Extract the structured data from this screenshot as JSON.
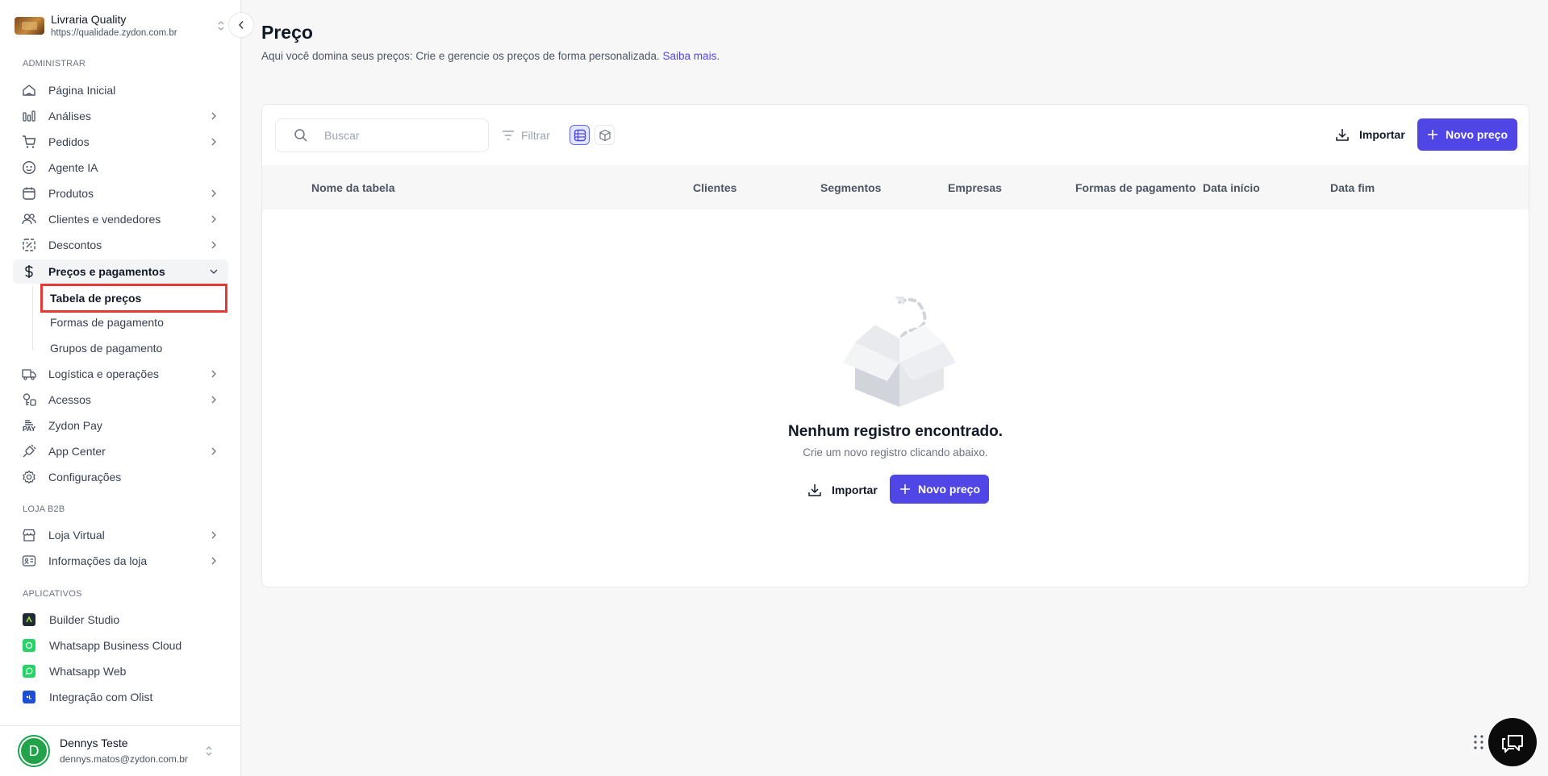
{
  "sidebar": {
    "brand": {
      "name": "Livraria Quality",
      "url": "https://qualidade.zydon.com.br"
    },
    "sections": {
      "admin": "ADMINISTRAR",
      "store": "LOJA B2B",
      "apps": "APLICATIVOS"
    },
    "items": {
      "home": "Página Inicial",
      "analytics": "Análises",
      "orders": "Pedidos",
      "ai_agent": "Agente IA",
      "products": "Produtos",
      "clients": "Clientes e vendedores",
      "discounts": "Descontos",
      "prices": "Preços e pagamentos",
      "logistics": "Logística e operações",
      "access": "Acessos",
      "zydon_pay": "Zydon Pay",
      "app_center": "App Center",
      "settings": "Configurações",
      "virtual_store": "Loja Virtual",
      "store_info": "Informações da loja"
    },
    "subitems": {
      "price_table": "Tabela de preços",
      "payment_methods": "Formas de pagamento",
      "payment_groups": "Grupos de pagamento"
    },
    "apps": {
      "builder": "Builder Studio",
      "whatsapp_cloud": "Whatsapp Business Cloud",
      "whatsapp_web": "Whatsapp Web",
      "olist": "Integração com Olist"
    },
    "pay_icon_text": "PAY",
    "user": {
      "initial": "D",
      "name": "Dennys Teste",
      "email": "dennys.matos@zydon.com.br"
    }
  },
  "main": {
    "title": "Preço",
    "description": "Aqui você domina seus preços: Crie e gerencie os preços de forma personalizada.",
    "learn_more": "Saiba mais",
    "learn_more_suffix": ".",
    "toolbar": {
      "search_placeholder": "Buscar",
      "filter_label": "Filtrar",
      "import_label": "Importar",
      "new_label": "Novo preço"
    },
    "table": {
      "columns": [
        "Nome da tabela",
        "Clientes",
        "Segmentos",
        "Empresas",
        "Formas de pagamento",
        "Data início",
        "Data fim"
      ]
    },
    "empty": {
      "title": "Nenhum registro encontrado.",
      "subtitle": "Crie um novo registro clicando abaixo.",
      "import_label": "Importar",
      "new_label": "Novo preço"
    }
  },
  "colors": {
    "accent": "#4f46e5",
    "highlight_border": "#e53935",
    "avatar": "#22a34a"
  },
  "icons": {
    "home": "home-icon",
    "analytics": "bar-chart-icon",
    "orders": "cart-icon",
    "ai_agent": "robot-icon",
    "products": "calendar-box-icon",
    "clients": "users-icon",
    "discounts": "discount-icon",
    "prices": "dollar-icon",
    "logistics": "truck-icon",
    "access": "key-icon",
    "app_center": "plug-icon",
    "settings": "gear-icon",
    "virtual_store": "store-icon",
    "store_info": "id-card-icon",
    "chat": "chat-icon"
  }
}
